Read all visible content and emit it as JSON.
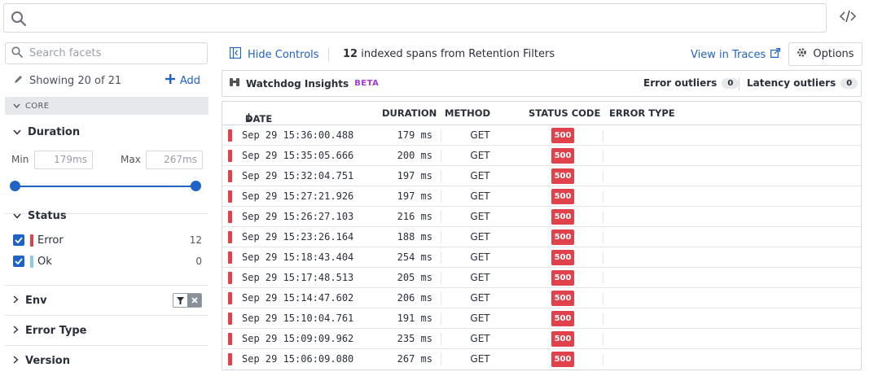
{
  "top_search": {
    "placeholder": ""
  },
  "facets": {
    "search_placeholder": "Search facets",
    "showing_text": "Showing 20 of 21",
    "add_label": "Add",
    "core_label": "CORE",
    "duration": {
      "title": "Duration",
      "min_label": "Min",
      "min_value": "179ms",
      "max_label": "Max",
      "max_value": "267ms"
    },
    "status": {
      "title": "Status",
      "items": [
        {
          "label": "Error",
          "count": "12",
          "color": "#e0414a",
          "checked": true
        },
        {
          "label": "Ok",
          "count": "0",
          "color": "#8ecae6",
          "checked": true
        }
      ]
    },
    "collapsed": [
      {
        "label": "Env"
      },
      {
        "label": "Error Type"
      },
      {
        "label": "Version"
      }
    ]
  },
  "toolbar": {
    "hide_controls": "Hide Controls",
    "span_count": "12",
    "span_text": "indexed spans from Retention Filters",
    "view_in_traces": "View in Traces",
    "options": "Options"
  },
  "watchdog": {
    "title": "Watchdog Insights",
    "beta": "BETA",
    "error_outliers_label": "Error outliers",
    "error_outliers_count": "0",
    "latency_outliers_label": "Latency outliers",
    "latency_outliers_count": "0"
  },
  "table": {
    "columns": {
      "date": "DATE",
      "duration": "DURATION",
      "method": "METHOD",
      "status": "STATUS CODE",
      "error": "ERROR TYPE"
    },
    "rows": [
      {
        "date": "Sep 29 15:36:00.488",
        "duration": "179 ms",
        "method": "GET",
        "status": "500"
      },
      {
        "date": "Sep 29 15:35:05.666",
        "duration": "200 ms",
        "method": "GET",
        "status": "500"
      },
      {
        "date": "Sep 29 15:32:04.751",
        "duration": "197 ms",
        "method": "GET",
        "status": "500"
      },
      {
        "date": "Sep 29 15:27:21.926",
        "duration": "197 ms",
        "method": "GET",
        "status": "500"
      },
      {
        "date": "Sep 29 15:26:27.103",
        "duration": "216 ms",
        "method": "GET",
        "status": "500"
      },
      {
        "date": "Sep 29 15:23:26.164",
        "duration": "188 ms",
        "method": "GET",
        "status": "500"
      },
      {
        "date": "Sep 29 15:18:43.404",
        "duration": "254 ms",
        "method": "GET",
        "status": "500"
      },
      {
        "date": "Sep 29 15:17:48.513",
        "duration": "205 ms",
        "method": "GET",
        "status": "500"
      },
      {
        "date": "Sep 29 15:14:47.602",
        "duration": "206 ms",
        "method": "GET",
        "status": "500"
      },
      {
        "date": "Sep 29 15:10:04.761",
        "duration": "191 ms",
        "method": "GET",
        "status": "500"
      },
      {
        "date": "Sep 29 15:09:09.962",
        "duration": "235 ms",
        "method": "GET",
        "status": "500"
      },
      {
        "date": "Sep 29 15:06:09.080",
        "duration": "267 ms",
        "method": "GET",
        "status": "500"
      }
    ]
  }
}
